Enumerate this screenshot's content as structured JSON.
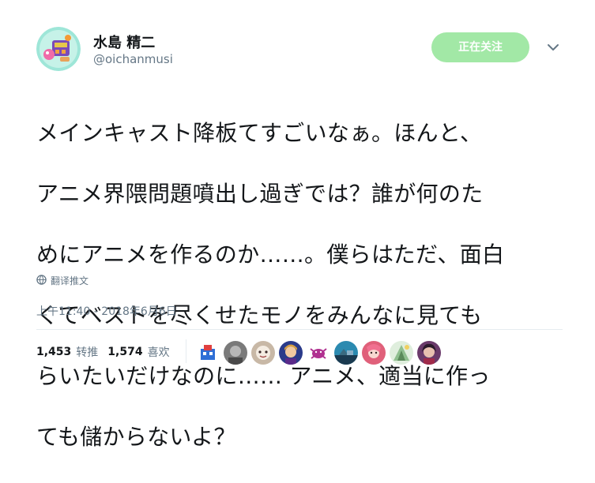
{
  "author": {
    "display_name": "水島 精二",
    "handle": "@oichanmusi",
    "avatar_icon": "toy-robot-avatar-icon"
  },
  "follow_button": {
    "label": "正在关注",
    "color": "#a2e8a6"
  },
  "menu_icon": "chevron-down-icon",
  "tweet": {
    "text_lines": [
      "メインキャスト降板てすごいなぁ。ほんと、",
      "アニメ界隈問題噴出し過ぎでは？誰が何のた",
      "めにアニメを作るのか……。僕らはただ、面白",
      "くてベストを尽くせたモノをみんなに見ても",
      "らいたいだけなのに…… アニメ、適当に作っ",
      "ても儲からないよ？"
    ]
  },
  "translate": {
    "label": "翻译推文",
    "icon": "globe-icon"
  },
  "timestamp": "上午11:40 - 2018年6月6日",
  "stats": {
    "retweets_count": "1,453",
    "retweets_label": "转推",
    "likes_count": "1,574",
    "likes_label": "喜欢"
  },
  "likers": [
    {
      "name": "liker-avatar-1",
      "color": "#2f6fd6"
    },
    {
      "name": "liker-avatar-2",
      "color": "#7a7a7a"
    },
    {
      "name": "liker-avatar-3",
      "color": "#c8b8a6"
    },
    {
      "name": "liker-avatar-4",
      "color": "#2a3a8a"
    },
    {
      "name": "liker-avatar-5",
      "color": "#b03090"
    },
    {
      "name": "liker-avatar-6",
      "color": "#2b8ab0"
    },
    {
      "name": "liker-avatar-7",
      "color": "#e0607a"
    },
    {
      "name": "liker-avatar-8",
      "color": "#8fbf8f"
    },
    {
      "name": "liker-avatar-9",
      "color": "#6a3a6a"
    }
  ],
  "colors": {
    "primary_text": "#14171a",
    "secondary_text": "#657786",
    "divider": "#e6ecf0"
  }
}
